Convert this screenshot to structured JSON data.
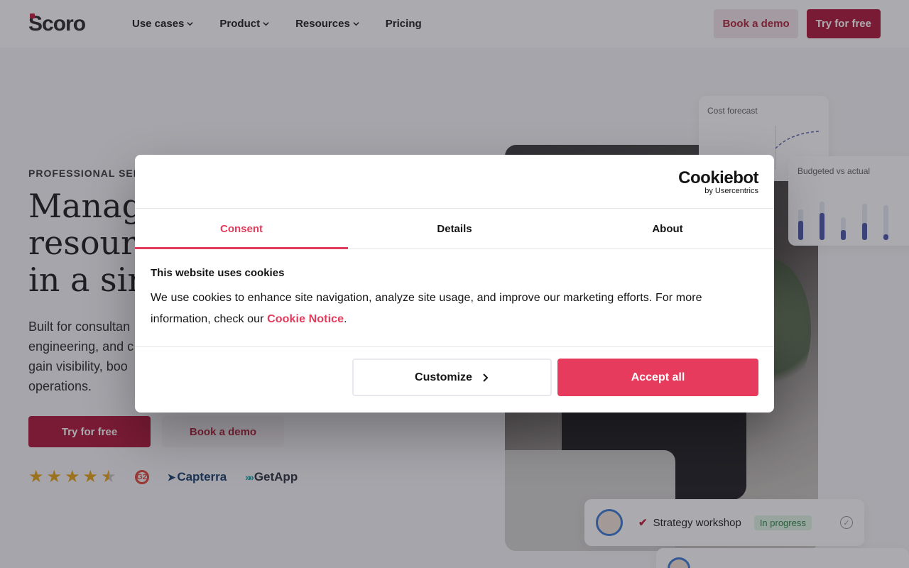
{
  "header": {
    "logo_text": "Scoro",
    "nav": [
      {
        "label": "Use cases",
        "has_dropdown": true
      },
      {
        "label": "Product",
        "has_dropdown": true
      },
      {
        "label": "Resources",
        "has_dropdown": true
      },
      {
        "label": "Pricing",
        "has_dropdown": false
      }
    ],
    "book_demo": "Book a demo",
    "try_free": "Try for free"
  },
  "hero": {
    "eyebrow": "PROFESSIONAL SERV",
    "headline_lines": [
      "Manage",
      "resource",
      "in a sing"
    ],
    "description_lines": [
      "Built for consultan",
      "engineering, and c",
      "gain visibility, boo",
      "operations."
    ],
    "try_free": "Try for free",
    "book_demo": "Book a demo",
    "rating_stars": 4.5,
    "review_sites": [
      "G2",
      "Capterra",
      "GetApp"
    ]
  },
  "visuals": {
    "cost_card_label": "Cost forecast",
    "budget_card_label": "Budgeted vs actual",
    "budget_bars": [
      {
        "budget": 0.8,
        "actual": 0.5
      },
      {
        "budget": 1.0,
        "actual": 0.7
      },
      {
        "budget": 0.6,
        "actual": 0.25
      },
      {
        "budget": 0.95,
        "actual": 0.45
      },
      {
        "budget": 0.9,
        "actual": 0.15
      }
    ],
    "task": {
      "title": "Strategy workshop",
      "status": "In progress"
    }
  },
  "cookie_dialog": {
    "brand": "Cookiebot",
    "brand_sub": "by Usercentrics",
    "tabs": [
      {
        "label": "Consent",
        "active": true
      },
      {
        "label": "Details",
        "active": false
      },
      {
        "label": "About",
        "active": false
      }
    ],
    "title": "This website uses cookies",
    "text_before_link": "We use cookies to enhance site navigation, analyze site usage, and improve our marketing efforts. For more information, check our ",
    "link_text": "Cookie Notice",
    "text_after_link": ".",
    "customize": "Customize",
    "accept_all": "Accept all"
  },
  "colors": {
    "brand_red": "#b0183a",
    "cookiebot_accent": "#e63b5c"
  }
}
